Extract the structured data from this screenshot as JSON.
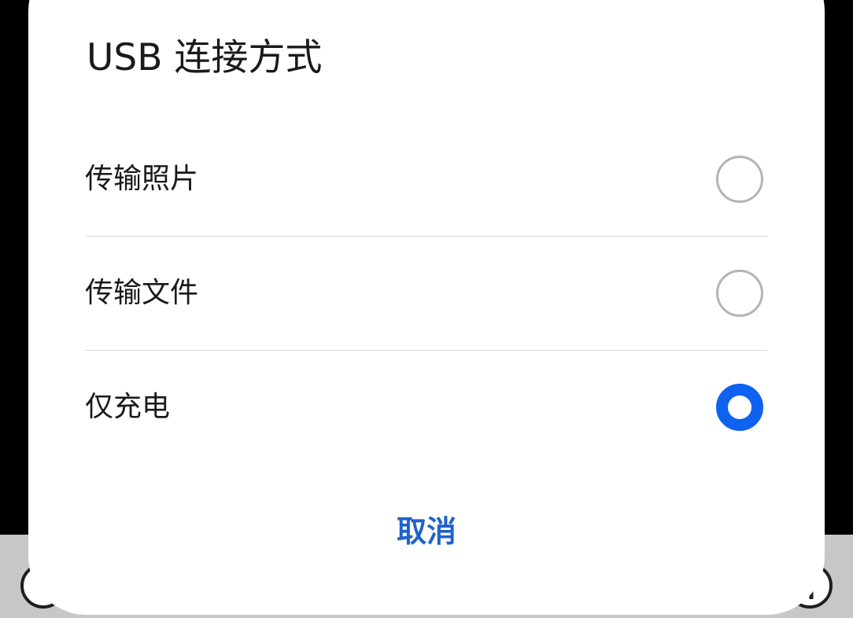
{
  "dialog": {
    "title": "USB 连接方式",
    "options": [
      {
        "label": "传输照片",
        "selected": false
      },
      {
        "label": "传输文件",
        "selected": false
      },
      {
        "label": "仅充电",
        "selected": true
      }
    ],
    "cancel_label": "取消"
  },
  "colors": {
    "accent": "#0f62f0",
    "cancel_text": "#1f62c9",
    "radio_unselected": "#b4b4b4",
    "title_text": "#1a1a1a",
    "divider": "#d9d9d9",
    "backdrop_top": "#000000",
    "backdrop_bottom": "#c7c7c7"
  },
  "background_icons": [
    "partial-circle-icon",
    "partial-circle-icon"
  ]
}
